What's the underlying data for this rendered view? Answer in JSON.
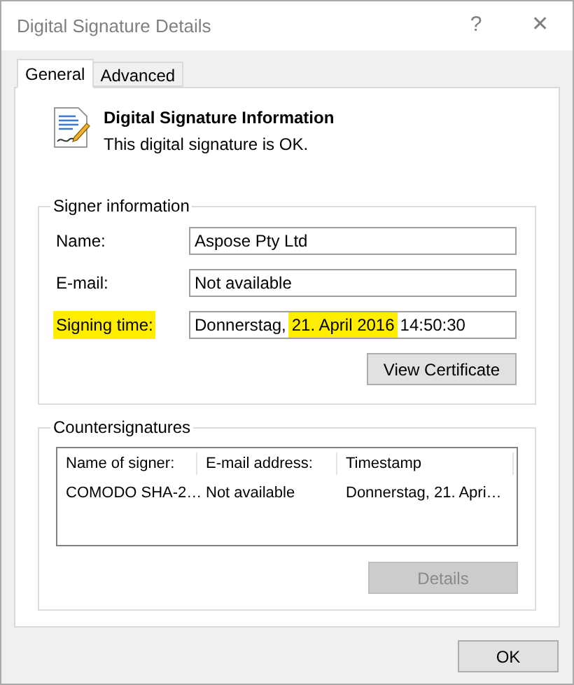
{
  "window": {
    "title": "Digital Signature Details",
    "help": "?",
    "close": "✕"
  },
  "tabs": [
    {
      "label": "General",
      "selected": true
    },
    {
      "label": "Advanced",
      "selected": false
    }
  ],
  "header": {
    "title": "Digital Signature Information",
    "status": "This digital signature is OK."
  },
  "signer_information": {
    "title": "Signer information",
    "fields": [
      {
        "label": "Name:",
        "highlighted": false,
        "value_parts": [
          {
            "text": "Aspose Pty Ltd",
            "highlighted": false
          }
        ]
      },
      {
        "label": "E-mail:",
        "highlighted": false,
        "value_parts": [
          {
            "text": "Not available",
            "highlighted": false
          }
        ]
      },
      {
        "label": "Signing time:",
        "highlighted": true,
        "value_parts": [
          {
            "text": "Donnerstag,",
            "highlighted": false
          },
          {
            "text": "21. April 2016",
            "highlighted": true
          },
          {
            "text": "14:50:30",
            "highlighted": false
          }
        ]
      }
    ],
    "button": {
      "label": "View Certificate",
      "disabled": false
    }
  },
  "countersignatures": {
    "title": "Countersignatures",
    "columns": [
      "Name of signer:",
      "E-mail address:",
      "Timestamp"
    ],
    "rows": [
      [
        "COMODO SHA-2…",
        "Not available",
        "Donnerstag, 21. Apri…"
      ]
    ],
    "button": {
      "label": "Details",
      "disabled": true
    }
  },
  "buttons": [
    {
      "label": "OK"
    }
  ]
}
